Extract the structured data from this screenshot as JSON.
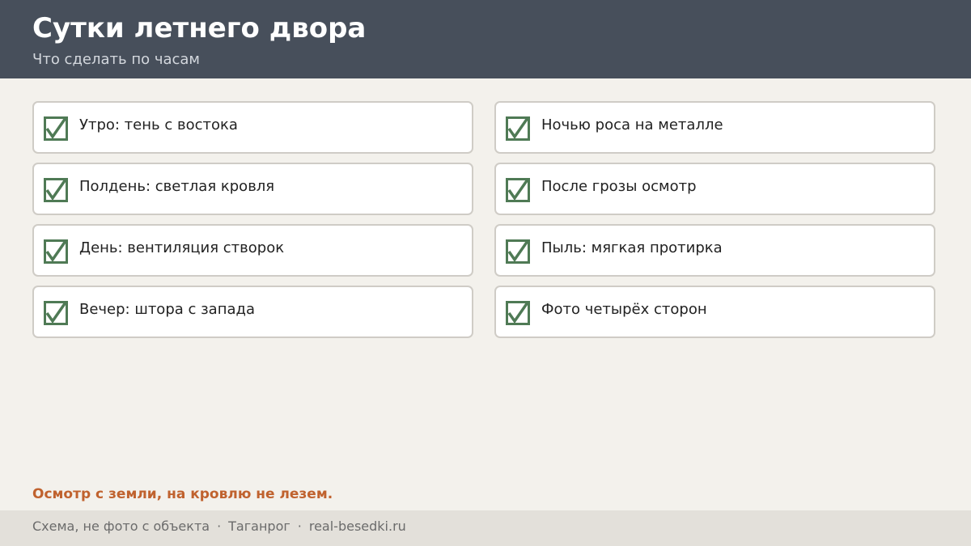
{
  "header": {
    "title": "Сутки летнего двора",
    "subtitle": "Что сделать по часам"
  },
  "checklist": {
    "items": [
      {
        "label": "Утро: тень с востока",
        "checked": true
      },
      {
        "label": "Ночью роса на металле",
        "checked": true
      },
      {
        "label": "Полдень: светлая кровля",
        "checked": true
      },
      {
        "label": "После грозы осмотр",
        "checked": true
      },
      {
        "label": "День: вентиляция створок",
        "checked": true
      },
      {
        "label": "Пыль: мягкая протирка",
        "checked": true
      },
      {
        "label": "Вечер: штора с запада",
        "checked": true
      },
      {
        "label": "Фото четырёх сторон",
        "checked": true
      }
    ]
  },
  "warning": "Осмотр с земли, на кровлю не лезем.",
  "footer": {
    "note": "Схема, не фото с объекта",
    "separator": "·",
    "city": "Таганрог",
    "site": "real-besedki.ru"
  },
  "colors": {
    "header_bg": "#474f5b",
    "page_bg": "#f3f1ec",
    "check_green": "#4f7a55",
    "warning_accent": "#c0622e",
    "footer_bg": "#e3e0da"
  },
  "icons": {
    "check": "checkbox-checked-icon"
  }
}
